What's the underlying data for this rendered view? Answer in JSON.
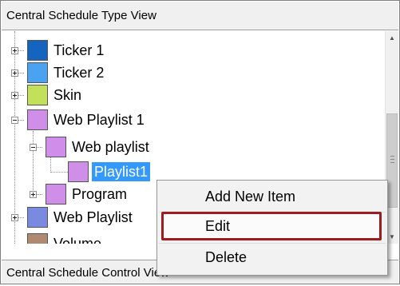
{
  "panel_title": "Central Schedule Type View",
  "bottom_panel_title": "Central Schedule Control View",
  "tree": {
    "items": [
      {
        "label": "Ticker 1",
        "color": "#1565c0"
      },
      {
        "label": "Ticker 2",
        "color": "#4aa3f0"
      },
      {
        "label": "Skin",
        "color": "#c2e05a"
      },
      {
        "label": "Web Playlist 1",
        "color": "#cf8ee8"
      },
      {
        "label": "Web playlist",
        "color": "#cf8ee8"
      },
      {
        "label": "Playlist1",
        "color": "#cf8ee8"
      },
      {
        "label": "Program",
        "color": "#cf8ee8"
      },
      {
        "label": "Web Playlist",
        "color": "#7a8ae0"
      },
      {
        "label": "Volume",
        "color": "#b08a70"
      }
    ],
    "selected_item": "Playlist1"
  },
  "context_menu": {
    "items": [
      "Add New Item",
      "Edit",
      "Delete"
    ],
    "highlighted": "Edit"
  },
  "colors": {
    "selection": "#3399ff",
    "highlight_border": "#9c1c22",
    "header_bg": "#f0f0f0"
  }
}
